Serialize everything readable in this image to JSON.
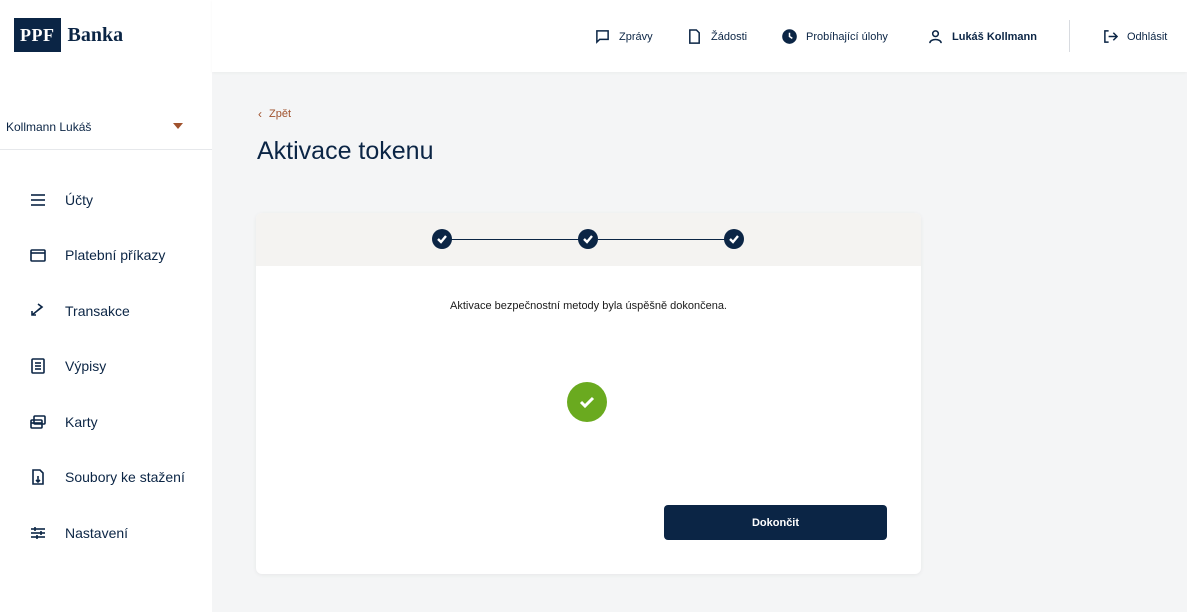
{
  "brand": {
    "logo_box": "PPF",
    "logo_text": "Banka"
  },
  "user_select": {
    "value": "Kollmann Lukáš"
  },
  "sidebar": {
    "items": [
      {
        "label": "Účty",
        "icon": "menu-icon"
      },
      {
        "label": "Platební příkazy",
        "icon": "folder-icon"
      },
      {
        "label": "Transakce",
        "icon": "transfer-arrows-icon"
      },
      {
        "label": "Výpisy",
        "icon": "document-list-icon"
      },
      {
        "label": "Karty",
        "icon": "cards-icon"
      },
      {
        "label": "Soubory ke stažení",
        "icon": "file-download-icon"
      },
      {
        "label": "Nastavení",
        "icon": "sliders-icon"
      }
    ]
  },
  "header": {
    "messages": "Zprávy",
    "requests": "Žádosti",
    "tasks": "Probíhající úlohy",
    "user": "Lukáš Kollmann",
    "logout": "Odhlásit"
  },
  "main": {
    "back": "Zpět",
    "title": "Aktivace tokenu",
    "message": "Aktivace bezpečnostní metody byla úspěšně dokončena.",
    "finish_button": "Dokončit"
  },
  "colors": {
    "primary": "#0b2545",
    "accent": "#a0522d",
    "success": "#6aaa1f"
  }
}
